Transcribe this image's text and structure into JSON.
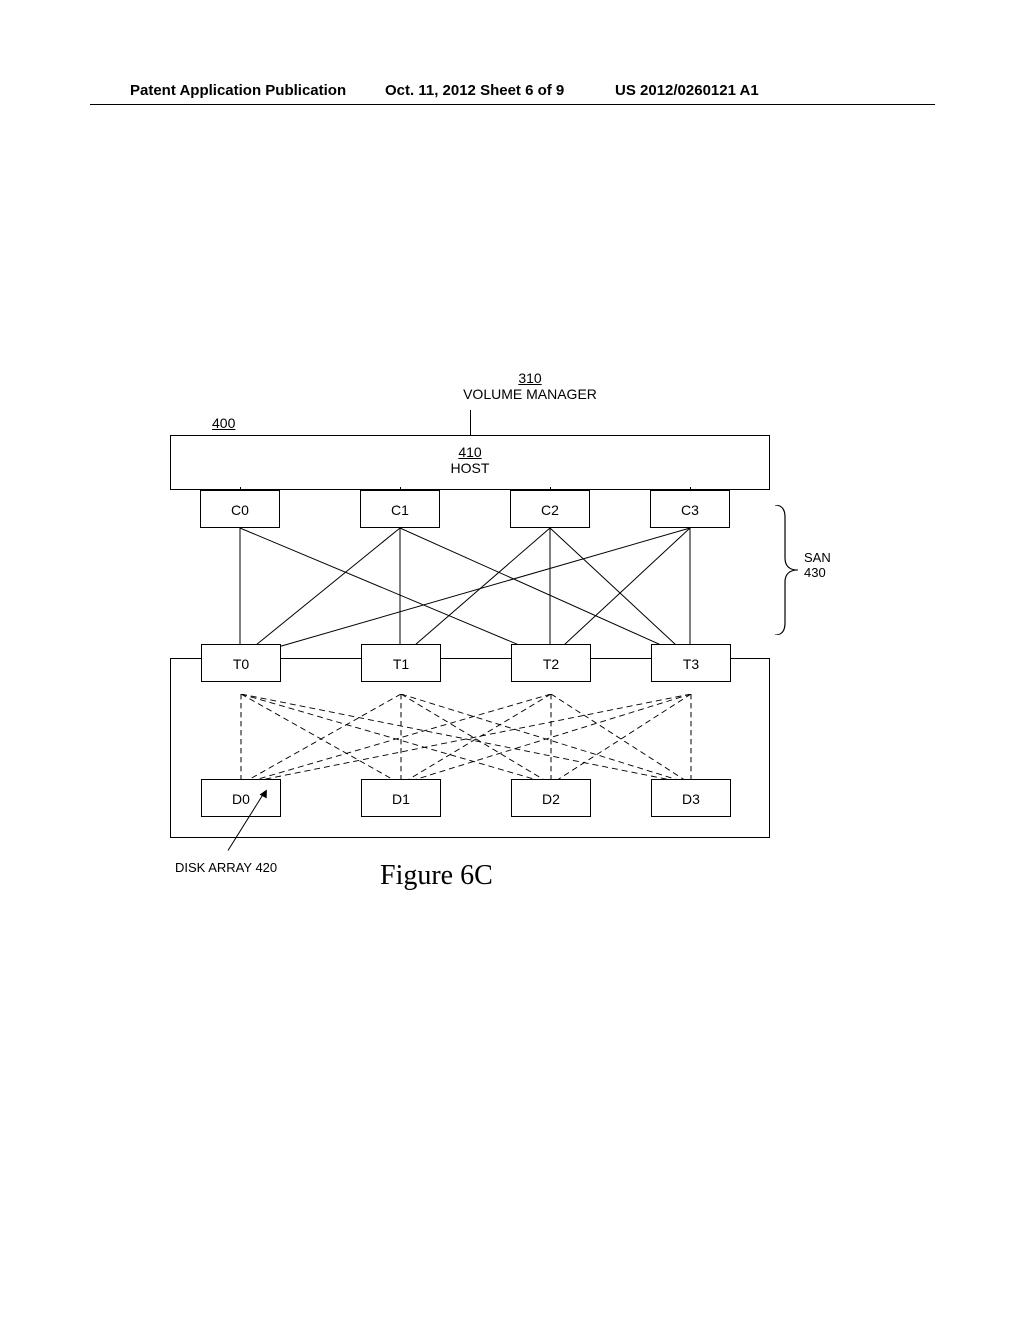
{
  "header": {
    "left": "Patent Application Publication",
    "center": "Oct. 11, 2012  Sheet 6 of 9",
    "right": "US 2012/0260121 A1"
  },
  "diagram": {
    "fig_ref": "400",
    "volume_manager": {
      "ref": "310",
      "label": "VOLUME MANAGER"
    },
    "host": {
      "ref": "410",
      "label": "HOST"
    },
    "controllers": [
      "C0",
      "C1",
      "C2",
      "C3"
    ],
    "targets": [
      "T0",
      "T1",
      "T2",
      "T3"
    ],
    "disks": [
      "D0",
      "D1",
      "D2",
      "D3"
    ],
    "san": {
      "label": "SAN",
      "ref": "430"
    },
    "disk_array": {
      "label": "DISK ARRAY 420"
    }
  },
  "figure_title": "Figure 6C"
}
